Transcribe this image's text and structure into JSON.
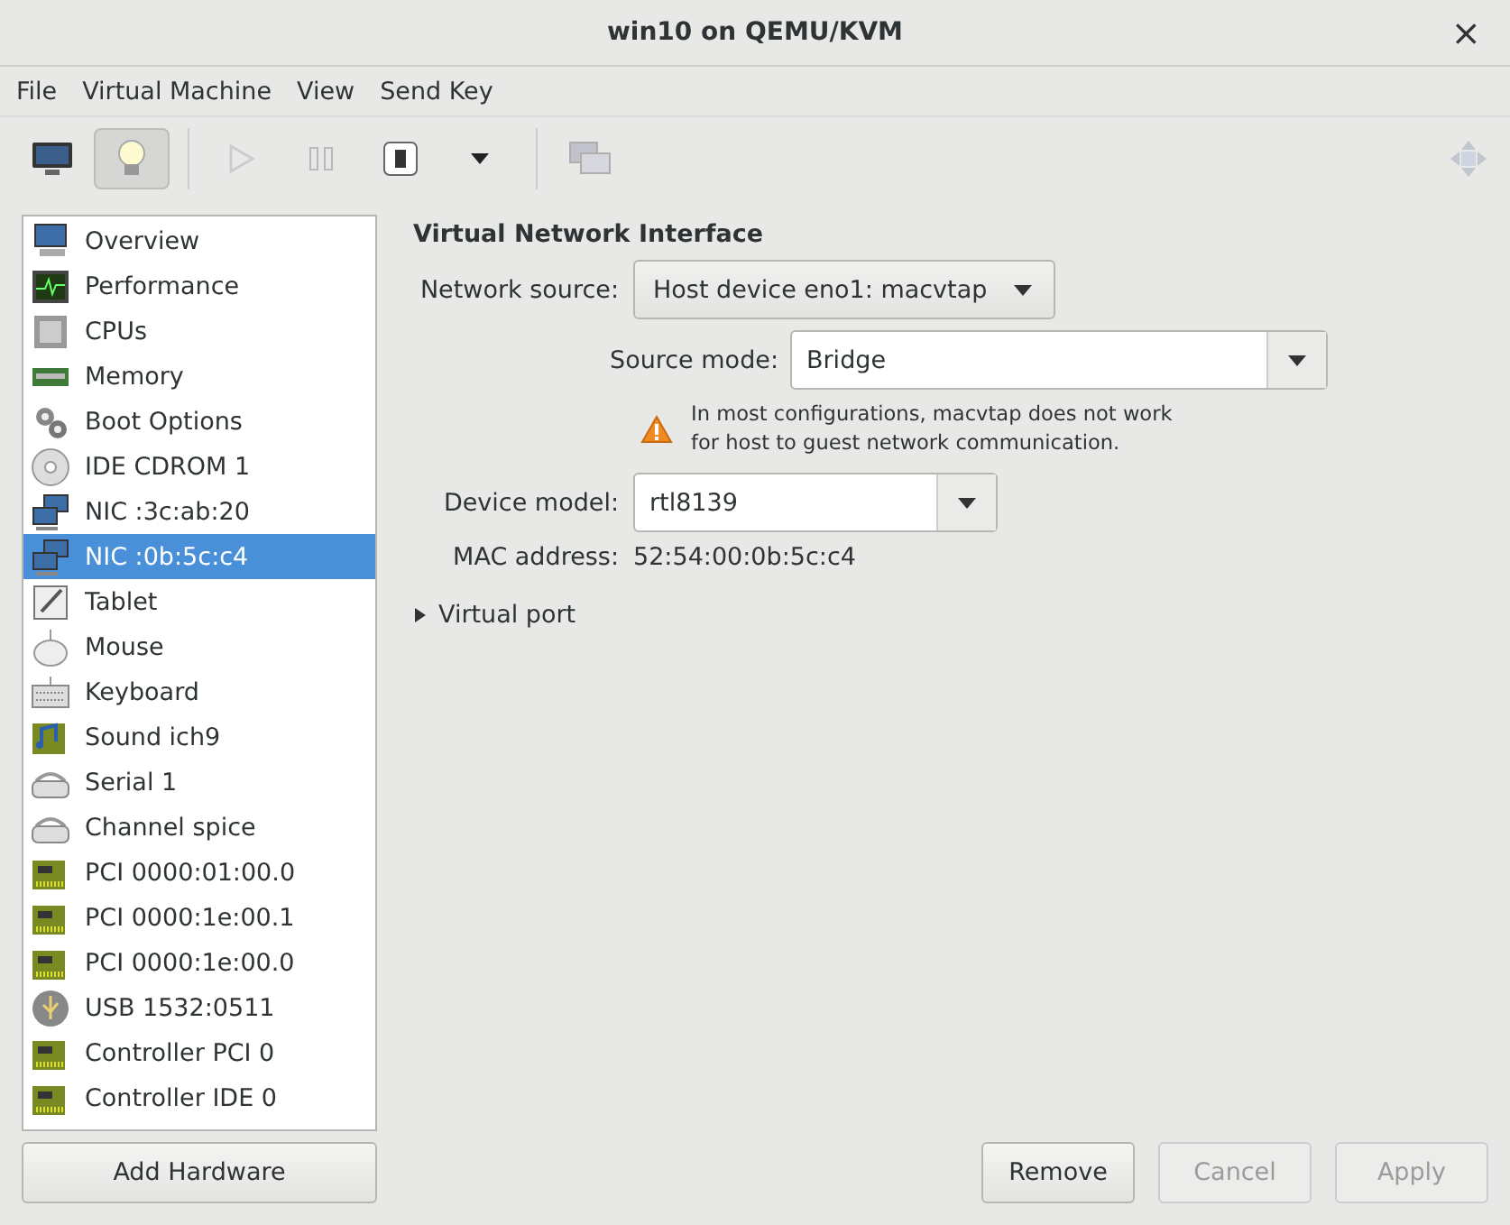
{
  "window": {
    "title": "win10 on QEMU/KVM",
    "close": "×"
  },
  "menu": [
    "File",
    "Virtual Machine",
    "View",
    "Send Key"
  ],
  "toolbar": [
    {
      "kind": "monitor",
      "selected": false,
      "disabled": false
    },
    {
      "kind": "bulb",
      "selected": true,
      "disabled": false
    },
    {
      "kind": "sep"
    },
    {
      "kind": "play",
      "selected": false,
      "disabled": true
    },
    {
      "kind": "pause",
      "selected": false,
      "disabled": true
    },
    {
      "kind": "power",
      "selected": false,
      "disabled": false
    },
    {
      "kind": "caret",
      "selected": false,
      "disabled": false
    },
    {
      "kind": "sep"
    },
    {
      "kind": "screens",
      "selected": false,
      "disabled": true
    }
  ],
  "sidebar": {
    "items": [
      {
        "kind": "monitor",
        "label": "Overview",
        "selected": false
      },
      {
        "kind": "perf",
        "label": "Performance",
        "selected": false
      },
      {
        "kind": "cpu",
        "label": "CPUs",
        "selected": false
      },
      {
        "kind": "memory",
        "label": "Memory",
        "selected": false
      },
      {
        "kind": "gears",
        "label": "Boot Options",
        "selected": false
      },
      {
        "kind": "disc",
        "label": "IDE CDROM 1",
        "selected": false
      },
      {
        "kind": "nic",
        "label": "NIC :3c:ab:20",
        "selected": false
      },
      {
        "kind": "nic",
        "label": "NIC :0b:5c:c4",
        "selected": true
      },
      {
        "kind": "tablet",
        "label": "Tablet",
        "selected": false
      },
      {
        "kind": "mouse",
        "label": "Mouse",
        "selected": false
      },
      {
        "kind": "keyboard",
        "label": "Keyboard",
        "selected": false
      },
      {
        "kind": "sound",
        "label": "Sound ich9",
        "selected": false
      },
      {
        "kind": "serial",
        "label": "Serial 1",
        "selected": false
      },
      {
        "kind": "serial",
        "label": "Channel spice",
        "selected": false
      },
      {
        "kind": "pci",
        "label": "PCI 0000:01:00.0",
        "selected": false
      },
      {
        "kind": "pci",
        "label": "PCI 0000:1e:00.1",
        "selected": false
      },
      {
        "kind": "pci",
        "label": "PCI 0000:1e:00.0",
        "selected": false
      },
      {
        "kind": "usb",
        "label": "USB 1532:0511",
        "selected": false
      },
      {
        "kind": "pci",
        "label": "Controller PCI 0",
        "selected": false
      },
      {
        "kind": "pci",
        "label": "Controller IDE 0",
        "selected": false
      }
    ],
    "add_button": "Add Hardware"
  },
  "details": {
    "heading": "Virtual Network Interface",
    "network_source": {
      "label": "Network source:",
      "value": "Host device eno1: macvtap"
    },
    "source_mode": {
      "label": "Source mode:",
      "value": "Bridge"
    },
    "warning": "In most configurations, macvtap does not work for host to guest network communication.",
    "device_model": {
      "label": "Device model:",
      "value": "rtl8139"
    },
    "mac": {
      "label": "MAC address:",
      "value": "52:54:00:0b:5c:c4"
    },
    "virtual_port": {
      "label": "Virtual port",
      "expanded": false
    }
  },
  "buttons": [
    {
      "label": "Remove",
      "disabled": false
    },
    {
      "label": "Cancel",
      "disabled": true
    },
    {
      "label": "Apply",
      "disabled": true
    }
  ]
}
